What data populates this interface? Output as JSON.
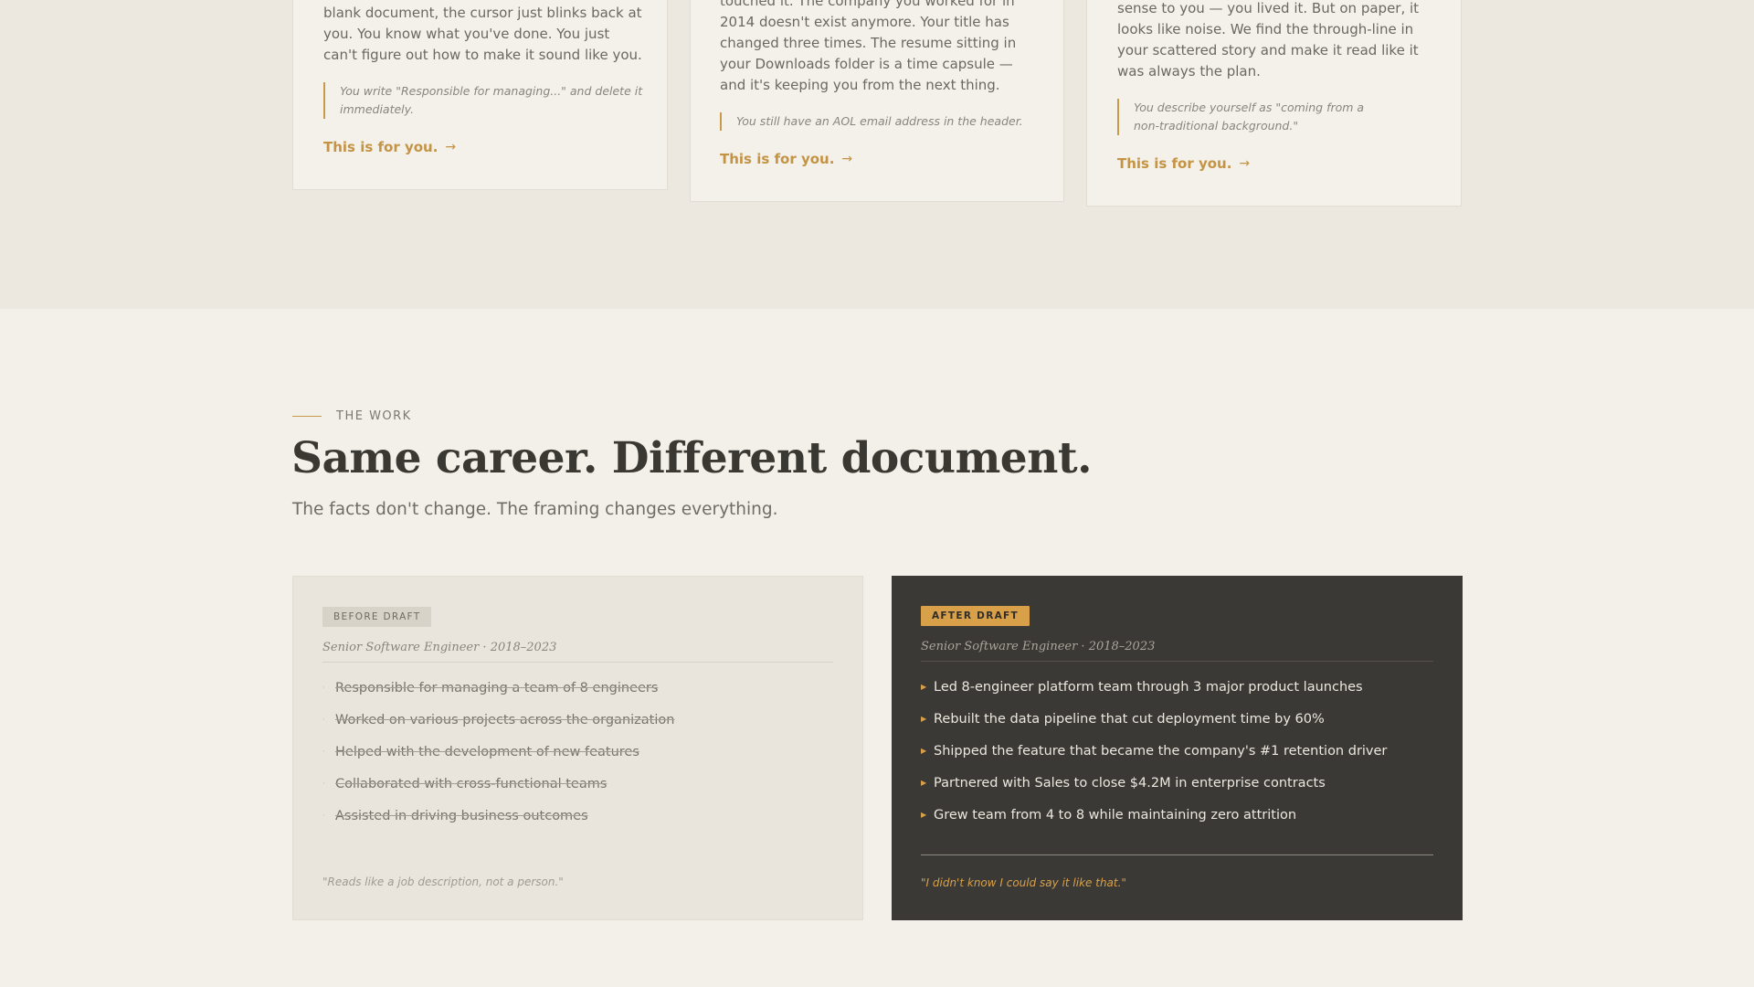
{
  "personas": [
    {
      "body": "blank document, the cursor just blinks back at you. You know what you've done. You just can't figure out how to make it sound like you.",
      "quote": "You write \"Responsible for managing...\" and delete it immediately.",
      "cta": "This is for you."
    },
    {
      "body": "touched it. The company you worked for in 2014 doesn't exist anymore. Your title has changed three times. The resume sitting in your Downloads folder is a time capsule — and it's keeping you from the next thing.",
      "quote": "You still have an AOL email address in the header.",
      "cta": "This is for you."
    },
    {
      "body": "sense to you — you lived it. But on paper, it looks like noise. We find the through-line in your scattered story and make it read like it was always the plan.",
      "quote": "You describe yourself as \"coming from a non-traditional background.\"",
      "cta": "This is for you."
    }
  ],
  "work": {
    "eyebrow": "THE WORK",
    "title": "Same career. Different document.",
    "subtitle": "The facts don't change. The framing changes everything."
  },
  "before": {
    "badge": "BEFORE DRAFT",
    "role": "Senior Software Engineer · 2018–2023",
    "bullets": [
      "Responsible for managing a team of 8 engineers",
      "Worked on various projects across the organization",
      "Helped with the development of new features",
      "Collaborated with cross-functional teams",
      "Assisted in driving business outcomes"
    ],
    "quote": "\"Reads like a job description, not a person.\""
  },
  "after": {
    "badge": "AFTER DRAFT",
    "role": "Senior Software Engineer · 2018–2023",
    "bullets": [
      "Led 8-engineer platform team through 3 major product launches",
      "Rebuilt the data pipeline that cut deployment time by 60%",
      "Shipped the feature that became the company's #1 retention driver",
      "Partnered with Sales to close $4.2M in enterprise contracts",
      "Grew team from 4 to 8 while maintaining zero attrition"
    ],
    "quote": "\"I didn't know I could say it like that.\""
  },
  "icons": {
    "cta_arrow": "arrow-right-icon",
    "before_bullet": "dot-icon",
    "after_bullet": "triangle-right-icon"
  },
  "colors": {
    "accent": "#c99a4a",
    "dark_panel": "#3b3935",
    "background": "#f3f0e9"
  }
}
